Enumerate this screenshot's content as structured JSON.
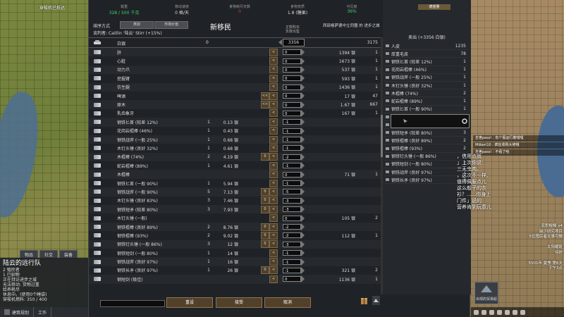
{
  "map": {
    "top_label": "穿梭机已抵达"
  },
  "left_tabs": [
    "物品",
    "社交",
    "装备"
  ],
  "caravan": {
    "name": "陆云的远行队",
    "lines": [
      "2 殖民者",
      "1 已驯物",
      "正在拜访进步之城",
      "无法移动: 货物过重",
      "给养耗尽",
      "休息中。(使用0个睡袋)",
      "穿梭机燃料: 350 / 400"
    ]
  },
  "bottom_bar": {
    "architect": "建筑规划",
    "work": "工作"
  },
  "stats": [
    {
      "label": "载重",
      "value": "328 / 500 千克",
      "color": "#3fd46a"
    },
    {
      "label": "移动速度",
      "value": "0 格/天",
      "color": "#dddddd"
    },
    {
      "label": "食物耗尽天数",
      "value": "0",
      "color": "#e04040"
    },
    {
      "label": "食物变质",
      "value": "1.8 (糖果)",
      "color": "#dddddd"
    },
    {
      "label": "可见度",
      "value": "36%",
      "color": "#3fd46a"
    }
  ],
  "sort": {
    "label": "排序方式",
    "btn1": "类别",
    "btn2": "市场价值"
  },
  "negotiator": "谈判者: Caitlin '陆云' Stirr (+15%)",
  "title": "新移民",
  "colhead": "正数购买\n负数出售",
  "faction": "西部格萨德中立同盟 的 进步之城",
  "silver": {
    "label": "白银",
    "colonist_qty": "0",
    "amount": "3356",
    "trader_qty": "3175"
  },
  "rows": [
    {
      "name": "肝",
      "cq": "",
      "cp": "",
      "amt": "0",
      "tp": "1394 银",
      "tq": "1",
      "b2": "",
      "b1": "<"
    },
    {
      "name": "心脏",
      "cq": "",
      "cp": "",
      "amt": "0",
      "tp": "1673 银",
      "tq": "1",
      "b2": "",
      "b1": "<"
    },
    {
      "name": "动力爪",
      "cq": "",
      "cp": "",
      "amt": "0",
      "tp": "537 银",
      "tq": "1",
      "b2": "",
      "b1": "<"
    },
    {
      "name": "挖掘臂",
      "cq": "",
      "cp": "",
      "amt": "0",
      "tp": "593 银",
      "tq": "1",
      "b2": "",
      "b1": "<"
    },
    {
      "name": "仿生腿",
      "cq": "",
      "cp": "",
      "amt": "0",
      "tp": "1436 银",
      "tq": "1",
      "b2": "",
      "b1": "<"
    },
    {
      "name": "啤酒",
      "cq": "",
      "cp": "",
      "amt": "0",
      "tp": "17 银",
      "tq": "47",
      "b2": "<<",
      "b1": "<"
    },
    {
      "name": "原木",
      "cq": "",
      "cp": "",
      "amt": "0",
      "tp": "1.67 银",
      "tq": "667",
      "b2": "<<",
      "b1": "<"
    },
    {
      "name": "乳齿象牙",
      "cq": "",
      "cp": "",
      "amt": "0",
      "tp": "167 银",
      "tq": "1",
      "b2": "",
      "b1": "<"
    },
    {
      "name": "钢铁匕首 (较差 12%)",
      "cq": "1",
      "cp": "0.13 银",
      "amt": "-1",
      "tp": "",
      "tq": "",
      "b2": "",
      "b1": "<"
    },
    {
      "name": "花岗岩棍棒 (46%)",
      "cq": "1",
      "cp": "0.43 银",
      "amt": "-1",
      "tp": "",
      "tq": "",
      "b2": "",
      "b1": "<"
    },
    {
      "name": "钢铁战斧 (一般 25%)",
      "cq": "1",
      "cp": "0.68 银",
      "amt": "-1",
      "tp": "",
      "tq": "",
      "b2": "",
      "b1": "<"
    },
    {
      "name": "木钉头锤 (良好 32%)",
      "cq": "1",
      "cp": "0.68 银",
      "amt": "-1",
      "tp": "",
      "tq": "",
      "b2": "",
      "b1": "<"
    },
    {
      "name": "木棍棒 (74%)",
      "cq": "2",
      "cp": "4.19 银",
      "amt": "-2",
      "tp": "",
      "tq": "",
      "b2": "0",
      "b1": "<"
    },
    {
      "name": "蛇岩棍棒 (89%)",
      "cq": "1",
      "cp": "4.61 银",
      "amt": "-1",
      "tp": "",
      "tq": "",
      "b2": "",
      "b1": "<"
    },
    {
      "name": "木棍棒",
      "cq": "",
      "cp": "",
      "amt": "0",
      "tp": "71 银",
      "tq": "1",
      "b2": "",
      "b1": "<"
    },
    {
      "name": "钢铁匕首 (一般 90%)",
      "cq": "1",
      "cp": "5.94 银",
      "amt": "-1",
      "tp": "",
      "tq": "",
      "b2": "",
      "b1": "<"
    },
    {
      "name": "钢铁战斧 (一般 90%)",
      "cq": "5",
      "cp": "7.13 银",
      "amt": "-5",
      "tp": "",
      "tq": "",
      "b2": "0",
      "b1": "<"
    },
    {
      "name": "木钉头锤 (良好 83%)",
      "cq": "3",
      "cp": "7.46 银",
      "amt": "-3",
      "tp": "",
      "tq": "",
      "b2": "0",
      "b1": "<"
    },
    {
      "name": "钢铁短矛 (较差 80%)",
      "cq": "3",
      "cp": "7.93 银",
      "amt": "-3",
      "tp": "",
      "tq": "",
      "b2": "0",
      "b1": "<"
    },
    {
      "name": "木钉头锤 (一般)",
      "cq": "",
      "cp": "",
      "amt": "0",
      "tp": "105 银",
      "tq": "2",
      "b2": "",
      "b1": "<"
    },
    {
      "name": "钢铁棍棒 (良好 89%)",
      "cq": "2",
      "cp": "8.76 银",
      "amt": "-2",
      "tp": "",
      "tq": "",
      "b2": "0",
      "b1": "<"
    },
    {
      "name": "钢铁棍棒 (93%)",
      "cq": "2",
      "cp": "9.02 银",
      "amt": "-2",
      "tp": "112 银",
      "tq": "1",
      "b2": "0",
      "b1": "<"
    },
    {
      "name": "钢铁钉头锤 (一般 86%)",
      "cq": "3",
      "cp": "12 银",
      "amt": "-3",
      "tp": "",
      "tq": "",
      "b2": "0",
      "b1": "<"
    },
    {
      "name": "钢铁短剑 (一般 80%)",
      "cq": "1",
      "cp": "14 银",
      "amt": "-1",
      "tp": "",
      "tq": "",
      "b2": "",
      "b1": "<"
    },
    {
      "name": "钢铁战斧 (良好 97%)",
      "cq": "1",
      "cp": "16 银",
      "amt": "-1",
      "tp": "",
      "tq": "",
      "b2": "",
      "b1": "<"
    },
    {
      "name": "钢铁长矛 (良好 97%)",
      "cq": "1",
      "cp": "26 银",
      "amt": "-1",
      "tp": "321 银",
      "tq": "2",
      "b2": "0",
      "b1": "<"
    },
    {
      "name": "钢短剑 (极佳)",
      "cq": "",
      "cp": "",
      "amt": "0",
      "tp": "1136 银",
      "tq": "1",
      "b2": "",
      "b1": "<"
    }
  ],
  "actions": {
    "reset": "重设",
    "accept": "接受",
    "cancel": "取消"
  },
  "right_panel": {
    "header": "德望量",
    "sub": "卖出 (+3356 白银)",
    "items": [
      {
        "name": "人皮",
        "qty": "1235"
      },
      {
        "name": "厚重毛皮",
        "qty": "78"
      },
      {
        "name": "钢铁匕首 (较差 12%)",
        "qty": "1"
      },
      {
        "name": "花岗岩棍棒 (46%)",
        "qty": "1"
      },
      {
        "name": "钢铁战斧 (一般 25%)",
        "qty": "1"
      },
      {
        "name": "木钉头锤 (良好 32%)",
        "qty": "1"
      },
      {
        "name": "木棍棒 (74%)",
        "qty": "2"
      },
      {
        "name": "蛇岩棍棒 (89%)",
        "qty": "1"
      },
      {
        "name": "钢铁匕首 (一般 90%)",
        "qty": "1"
      },
      {
        "name": "钢铁战斧 (一般 90%)",
        "qty": "5"
      },
      {
        "name": "木钉头锤 (良好 83%)",
        "qty": "3"
      },
      {
        "name": "钢铁短矛 (较差 80%)",
        "qty": "3"
      },
      {
        "name": "钢铁棍棒 (良好 89%)",
        "qty": "2"
      },
      {
        "name": "钢铁棍棒 (93%)",
        "qty": "2"
      },
      {
        "name": "钢铁钉头锤 (一般 86%)",
        "qty": "3"
      },
      {
        "name": "钢铁短剑 (一般 80%)",
        "qty": "1"
      },
      {
        "name": "钢铁战斧 (良好 97%)",
        "qty": "1"
      },
      {
        "name": "钢铁长矛 (良好 97%)",
        "qty": "1"
      }
    ]
  },
  "messages": [
    "吉舍pass! : 有个假运行着嘿嘿",
    "Miikeri10 : 疯狂收购大佬哦",
    "吉舍pass! : 不看了哈"
  ],
  "speech": "，信用点就\n」上次你说'\n三天虫肉。\n，这次不一样,\n值得佩服点儿\n这么般子的衣\n衫？......你身上\n门件」说的\n营养肯到玩意儿",
  "right_labels": [
    "农积棍棒 x4",
    "缺少研究项目",
    "5位殖民者无事可做",
    "",
    "太阳耀斑",
    "待时",
    "",
    "5501年 夏季 第6天",
    "下午3点"
  ],
  "minimap_label": "出现的贸易船"
}
